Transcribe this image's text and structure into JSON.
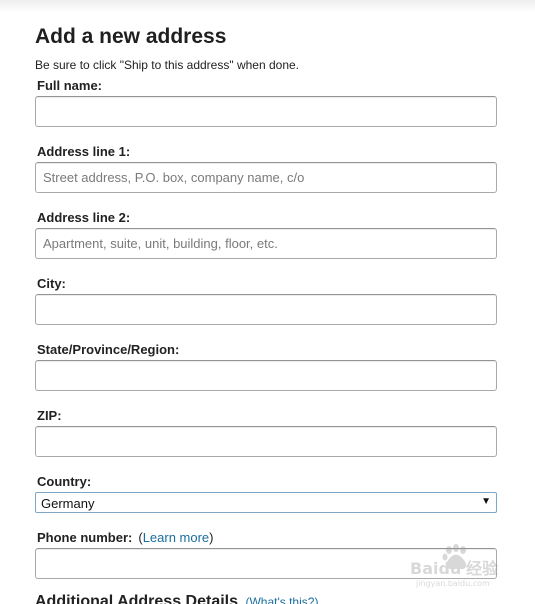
{
  "form": {
    "title": "Add a new address",
    "instruction": "Be sure to click \"Ship to this address\" when done.",
    "full_name": {
      "label": "Full name:",
      "value": "",
      "placeholder": ""
    },
    "address_line_1": {
      "label": "Address line 1:",
      "value": "",
      "placeholder": "Street address, P.O. box, company name, c/o"
    },
    "address_line_2": {
      "label": "Address line 2:",
      "value": "",
      "placeholder": "Apartment, suite, unit, building, floor, etc."
    },
    "city": {
      "label": "City:",
      "value": "",
      "placeholder": ""
    },
    "state": {
      "label": "State/Province/Region:",
      "value": "",
      "placeholder": ""
    },
    "zip": {
      "label": "ZIP:",
      "value": "",
      "placeholder": ""
    },
    "country": {
      "label": "Country:",
      "selected": "Germany",
      "icon": "chevron-down-icon",
      "glyph": "▼"
    },
    "phone": {
      "label": "Phone number:",
      "paren_open": "(",
      "help_link": "Learn more",
      "paren_close": ")",
      "value": "",
      "placeholder": ""
    },
    "additional_details": {
      "heading": "Additional Address Details",
      "paren_open": "(",
      "help_link": "What's this?",
      "paren_close": ")"
    }
  },
  "watermark": {
    "brand_text": "Baidu 经验",
    "url": "jingyan.baidu.com"
  },
  "colors": {
    "link": "#1a6e9e",
    "input_border": "#a9a9a9",
    "select_border": "#7ea7c7",
    "text": "#222222"
  }
}
